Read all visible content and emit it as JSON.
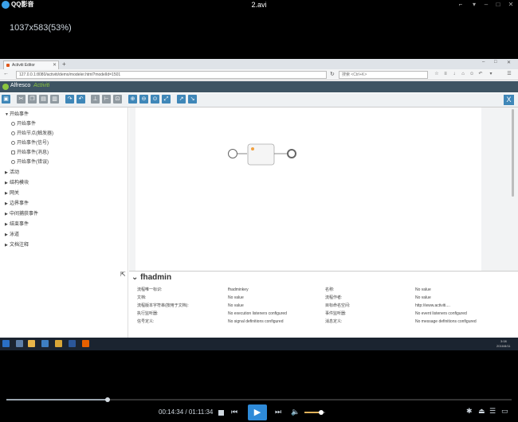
{
  "player": {
    "app_name": "QQ影音",
    "file_name": "2.avi",
    "resolution_info": "1037x583(53%)",
    "elapsed": "00:14:34",
    "total": "01:11:34",
    "progress_fraction": 0.2,
    "volume_fraction": 0.8,
    "accent": "#2e8ad8"
  },
  "browser": {
    "tab_title": "Activiti Editor",
    "url": "127.0.0.1:8080/activiti/demo/modeler.html?modelId=1501",
    "search_placeholder": "搜索 <Ctrl+K>"
  },
  "app": {
    "brand": "Alfresco",
    "product": "Activiti",
    "header_color": "#3e5463",
    "close_label": "X"
  },
  "palette": {
    "categories": [
      {
        "label": "开始事件",
        "expanded": true
      },
      {
        "label": "活动"
      },
      {
        "label": "结构模块"
      },
      {
        "label": "网关"
      },
      {
        "label": "边界事件"
      },
      {
        "label": "中间捕获事件"
      },
      {
        "label": "结束事件"
      },
      {
        "label": "泳道"
      },
      {
        "label": "文档注释"
      }
    ],
    "start_events": [
      {
        "label": "开始事件"
      },
      {
        "label": "开始节点(触发器)"
      },
      {
        "label": "开始事件(信号)"
      },
      {
        "label": "开始事件(消息)"
      },
      {
        "label": "开始事件(错误)"
      }
    ]
  },
  "properties": {
    "title": "fhadmin",
    "rows": [
      {
        "label": "流程唯一标识:",
        "value": "fhadminkey",
        "label2": "名称:",
        "value2": "No value"
      },
      {
        "label": "文档:",
        "value": "No value",
        "label2": "流程作者:",
        "value2": "No value"
      },
      {
        "label": "流程版本字符串(按用于文档):",
        "value": "No value",
        "label2": "目标命名空间:",
        "value2": "http://www.activiti...."
      },
      {
        "label": "执行监听器:",
        "value": "No execution listeners configured",
        "label2": "事件监听器:",
        "value2": "No event listeners configured"
      },
      {
        "label": "信号定义:",
        "value": "No signal definitions configured",
        "label2": "消息定义:",
        "value2": "No message definitions configured"
      }
    ]
  },
  "taskbar": {
    "time": "3:08",
    "date": "2016/8/11"
  }
}
